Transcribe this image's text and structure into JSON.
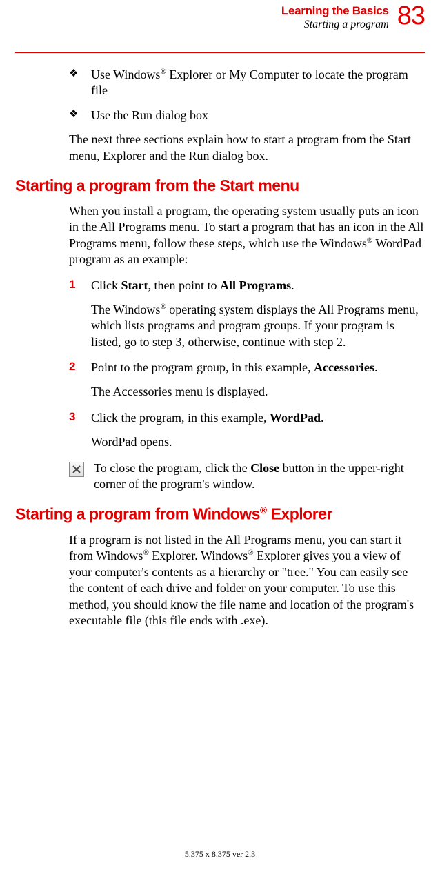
{
  "header": {
    "chapter_title": "Learning the Basics",
    "section_title": "Starting a program",
    "page_number": "83"
  },
  "bullets": [
    {
      "pre": "Use Windows",
      "sup": "®",
      "post": " Explorer or My Computer to locate the program file"
    },
    {
      "pre": "Use the Run dialog box",
      "sup": "",
      "post": ""
    }
  ],
  "intro_para": "The next three sections explain how to start a program from the Start menu, Explorer and the Run dialog box.",
  "heading1": "Starting a program from the Start menu",
  "para1_pre": "When you install a program, the operating system usually puts an icon in the All Programs menu. To start a program that has an icon in the All Programs menu, follow these steps, which use the Windows",
  "para1_sup": "®",
  "para1_post": " WordPad program as an example:",
  "steps": [
    {
      "num": "1",
      "text_pre": "Click ",
      "bold1": "Start",
      "text_mid": ", then point to ",
      "bold2": "All Programs",
      "text_post": ".",
      "after_pre": "The Windows",
      "after_sup": "®",
      "after_post": " operating system displays the All Programs menu, which lists programs and program groups. If your program is listed, go to step 3, otherwise, continue with step 2."
    },
    {
      "num": "2",
      "text_pre": "Point to the program group, in this example, ",
      "bold1": "Accessories",
      "text_mid": "",
      "bold2": "",
      "text_post": ".",
      "after_pre": "The Accessories menu is displayed.",
      "after_sup": "",
      "after_post": ""
    },
    {
      "num": "3",
      "text_pre": "Click the program, in this example, ",
      "bold1": "WordPad",
      "text_mid": "",
      "bold2": "",
      "text_post": ".",
      "after_pre": "WordPad opens.",
      "after_sup": "",
      "after_post": ""
    }
  ],
  "close_tip_pre": "To close the program, click the ",
  "close_tip_bold": "Close",
  "close_tip_post": " button in the upper-right corner of the program's window.",
  "heading2_pre": "Starting a program from Windows",
  "heading2_sup": "®",
  "heading2_post": " Explorer",
  "para2_a": "If a program is not listed in the All Programs menu, you can start it from Windows",
  "para2_sup1": "®",
  "para2_b": " Explorer. Windows",
  "para2_sup2": "®",
  "para2_c": " Explorer gives you a view of your computer's contents as a hierarchy or \"tree.\" You can easily see the content of each drive and folder on your computer. To use this method, you should know the file name and location of the program's executable file (this file ends with .exe).",
  "footer": "5.375 x 8.375 ver 2.3"
}
